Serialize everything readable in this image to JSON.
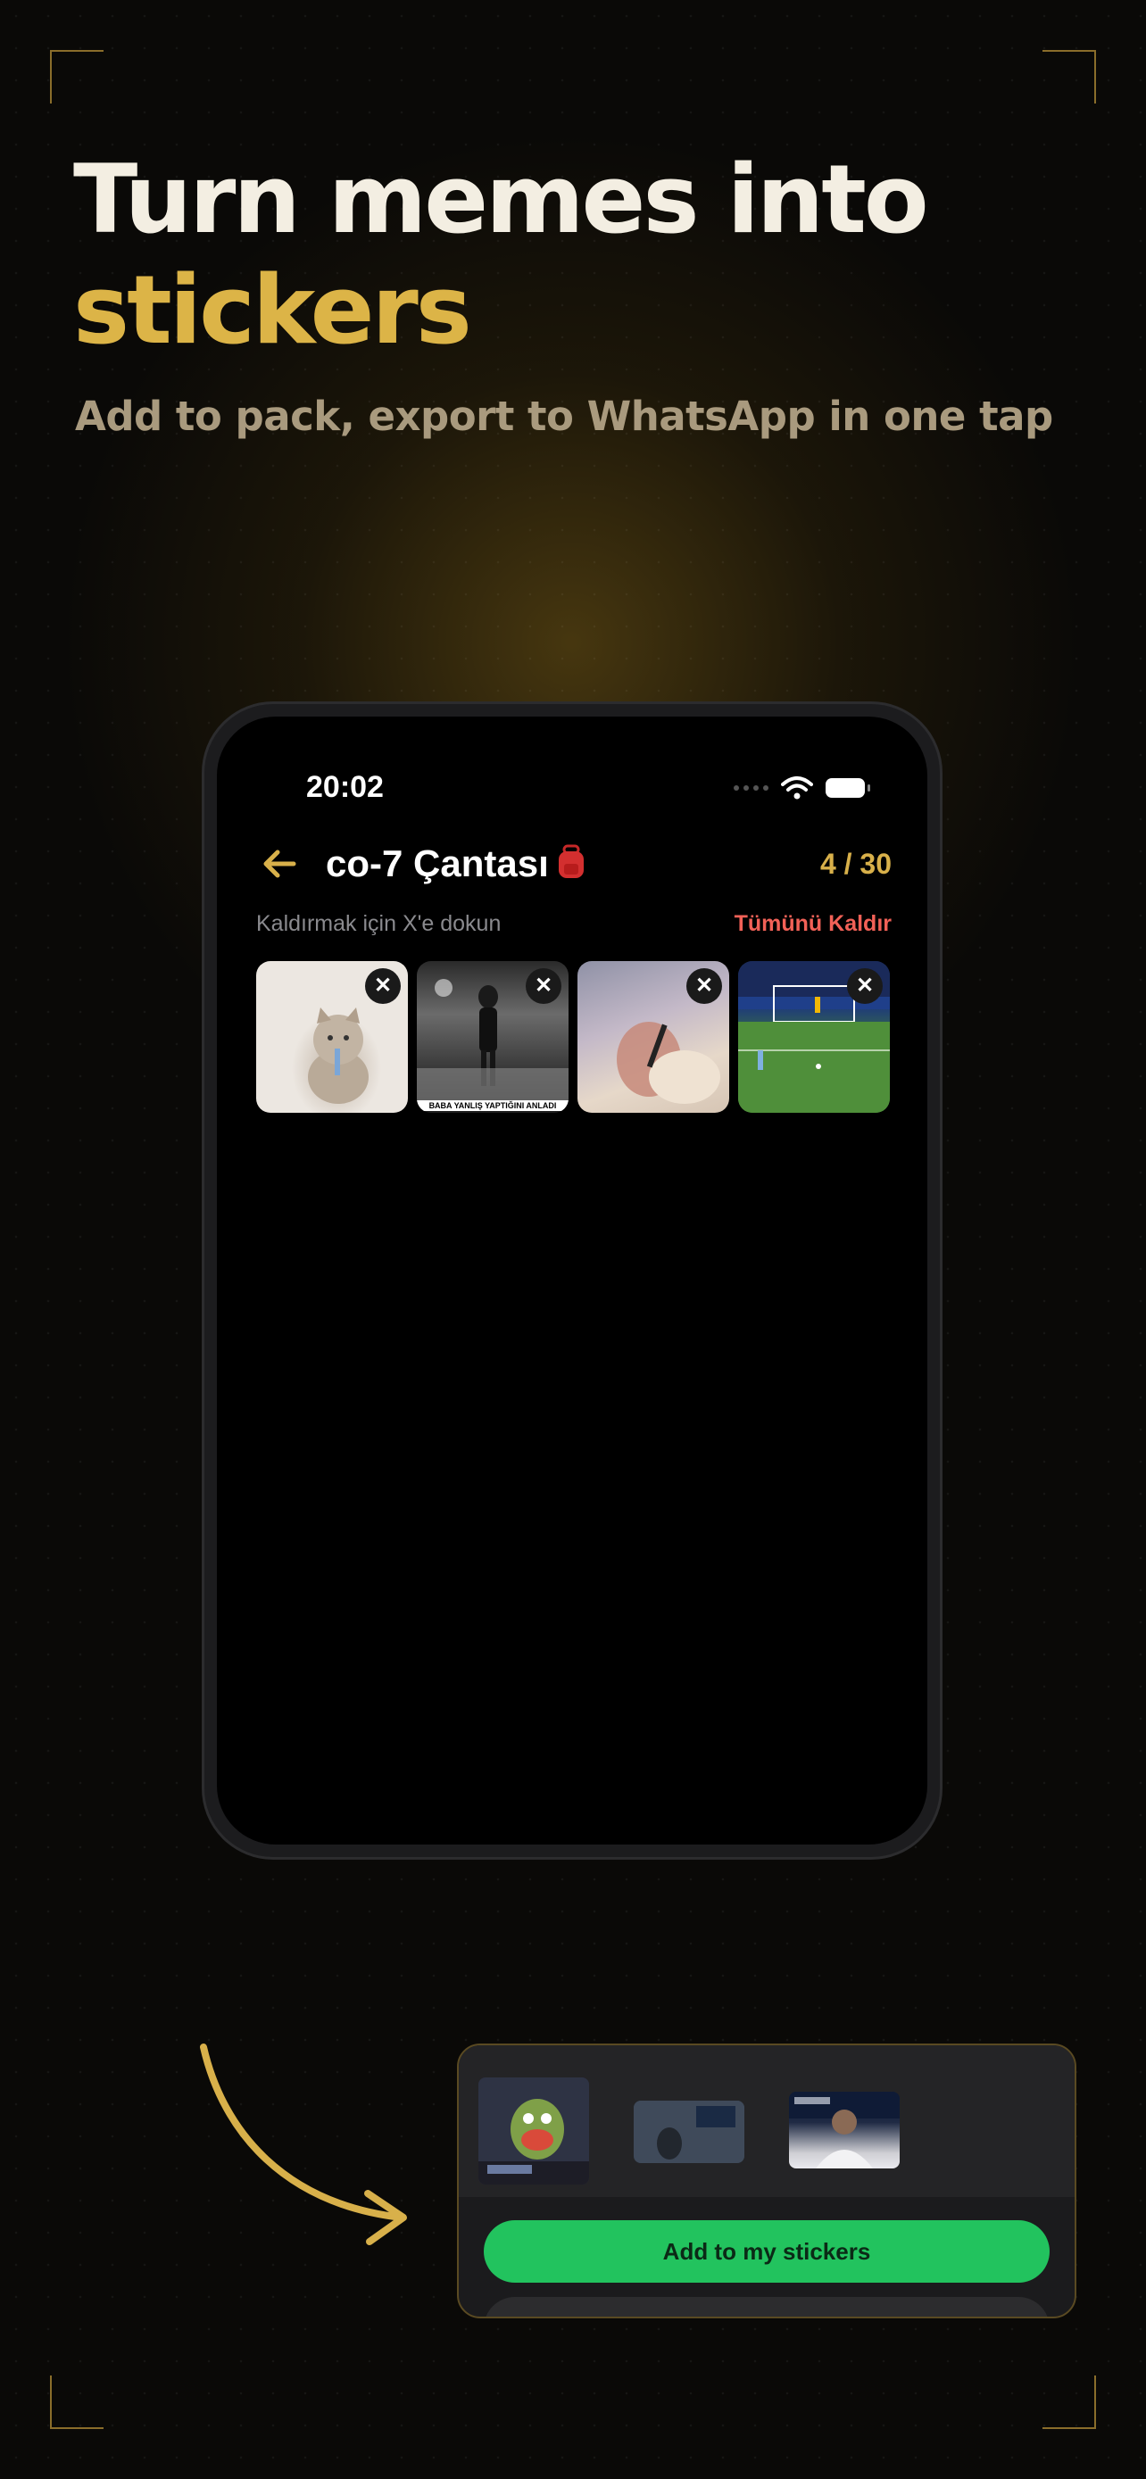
{
  "headline": {
    "line1": "Turn memes into",
    "line2": "stickers"
  },
  "subheadline": "Add to pack, export to WhatsApp in one tap",
  "colors": {
    "accent_gold": "#dcb447",
    "danger": "#f26157",
    "whatsapp_green": "#22c35e"
  },
  "phone": {
    "status": {
      "time": "20:02"
    },
    "nav": {
      "title": "co-7 Çantası",
      "title_emoji": "backpack-icon",
      "count": "4 / 30"
    },
    "hint": "Kaldırmak için X'e dokun",
    "remove_all": "Tümünü Kaldır",
    "stickers": [
      {
        "caption": "",
        "remove_label": "✕"
      },
      {
        "caption": "BABA YANLIŞ YAPTIĞINI ANLADI",
        "remove_label": "✕"
      },
      {
        "caption": "",
        "remove_label": "✕"
      },
      {
        "caption": "",
        "remove_label": "✕"
      }
    ]
  },
  "share_sheet": {
    "primary_button": "Add to my stickers"
  }
}
